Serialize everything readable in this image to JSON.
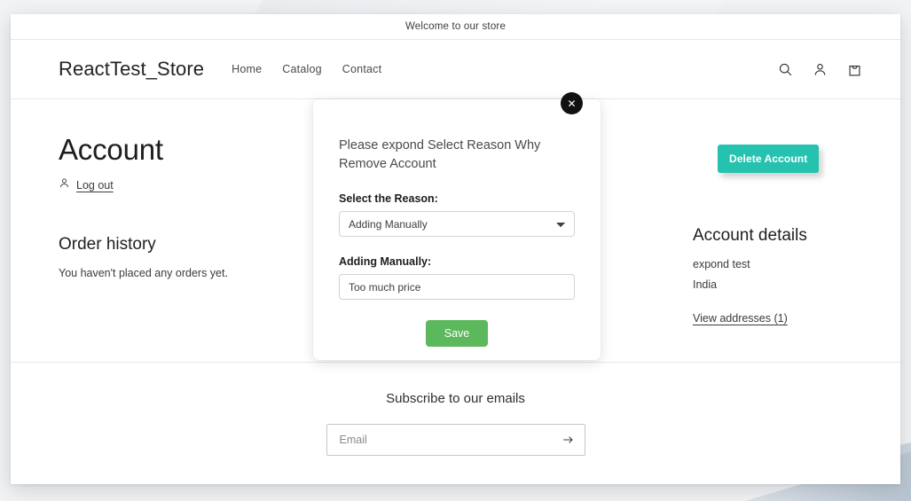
{
  "announcement": {
    "text": "Welcome to our store"
  },
  "header": {
    "logo": "ReactTest_Store",
    "nav": [
      {
        "label": "Home"
      },
      {
        "label": "Catalog"
      },
      {
        "label": "Contact"
      }
    ],
    "icons": {
      "search": "search-icon",
      "account": "account-icon",
      "cart": "cart-icon"
    }
  },
  "account": {
    "title": "Account",
    "logout_label": "Log out",
    "order_history_title": "Order history",
    "order_history_empty": "You haven't placed any orders yet."
  },
  "account_details": {
    "delete_button": "Delete Account",
    "delete_button_color": "#26c2b0",
    "title": "Account details",
    "name": "expond test",
    "country": "India",
    "view_addresses": "View addresses (1)"
  },
  "modal": {
    "close_label": "✕",
    "heading": "Please expond Select Reason Why Remove Account",
    "reason_label": "Select the Reason:",
    "reason_value": "Adding Manually",
    "reason_options": [
      "Adding Manually"
    ],
    "detail_label": "Adding Manually:",
    "detail_value": "Too much price",
    "detail_placeholder": "",
    "save_label": "Save",
    "save_button_color": "#5cb85c"
  },
  "footer": {
    "subscribe_title": "Subscribe to our emails",
    "email_placeholder": "Email",
    "email_value": "",
    "submit_icon": "arrow-right-icon"
  }
}
